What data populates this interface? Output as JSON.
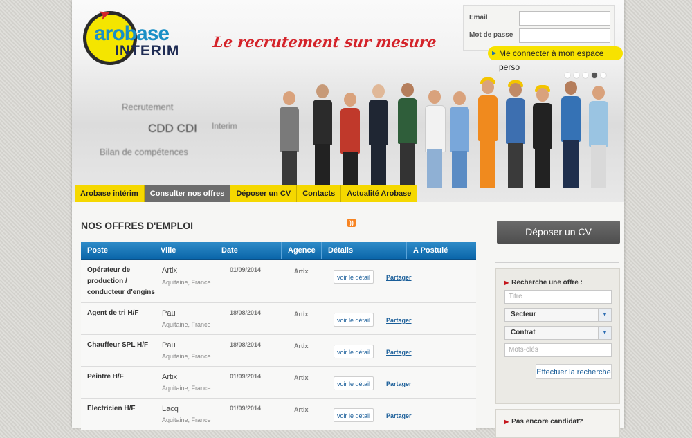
{
  "logo": {
    "word": "arobase",
    "sub": "INTERIM"
  },
  "tagline": "Le recrutement sur mesure",
  "login": {
    "email_label": "Email",
    "password_label": "Mot de passe",
    "connect_label": "Me connecter à mon espace perso"
  },
  "hero": {
    "words": [
      "Recrutement",
      "CDD CDI",
      "Interim",
      "Bilan de compétences"
    ],
    "slides": 5,
    "active_slide": 4
  },
  "nav": {
    "items": [
      {
        "label": "Arobase intérim"
      },
      {
        "label": "Consulter nos offres"
      },
      {
        "label": "Déposer un CV"
      },
      {
        "label": "Contacts"
      },
      {
        "label": "Actualité Arobase"
      }
    ],
    "active_index": 1
  },
  "offers": {
    "title": "NOS OFFRES D'EMPLOI",
    "columns": [
      "Poste",
      "Ville",
      "Date",
      "Agence",
      "Détails",
      "A Postulé"
    ],
    "rows": [
      {
        "poste": "Opérateur de production / conducteur d'engins",
        "ville": "Artix",
        "region": "Aquitaine, France",
        "date": "01/09/2014",
        "agence": "Artix",
        "detail": "voir le détail",
        "share": "Partager"
      },
      {
        "poste": "Agent de tri H/F",
        "ville": "Pau",
        "region": "Aquitaine, France",
        "date": "18/08/2014",
        "agence": "Artix",
        "detail": "voir le détail",
        "share": "Partager"
      },
      {
        "poste": "Chauffeur SPL H/F",
        "ville": "Pau",
        "region": "Aquitaine, France",
        "date": "18/08/2014",
        "agence": "Artix",
        "detail": "voir le détail",
        "share": "Partager"
      },
      {
        "poste": "Peintre H/F",
        "ville": "Artix",
        "region": "Aquitaine, France",
        "date": "01/09/2014",
        "agence": "Artix",
        "detail": "voir le détail",
        "share": "Partager"
      },
      {
        "poste": "Electricien H/F",
        "ville": "Lacq",
        "region": "Aquitaine, France",
        "date": "01/09/2014",
        "agence": "Artix",
        "detail": "voir le détail",
        "share": "Partager"
      }
    ]
  },
  "sidebar": {
    "cv_button": "Déposer un CV",
    "search_title": "Recherche une offre :",
    "title_placeholder": "Titre",
    "sector_label": "Secteur",
    "contract_label": "Contrat",
    "keywords_placeholder": "Mots-clés",
    "search_button": "Effectuer la recherche",
    "candidate_title": "Pas encore candidat?"
  },
  "colors": {
    "accent_yellow": "#f5d800",
    "blue": "#0b66a9",
    "red": "#d4232a"
  }
}
